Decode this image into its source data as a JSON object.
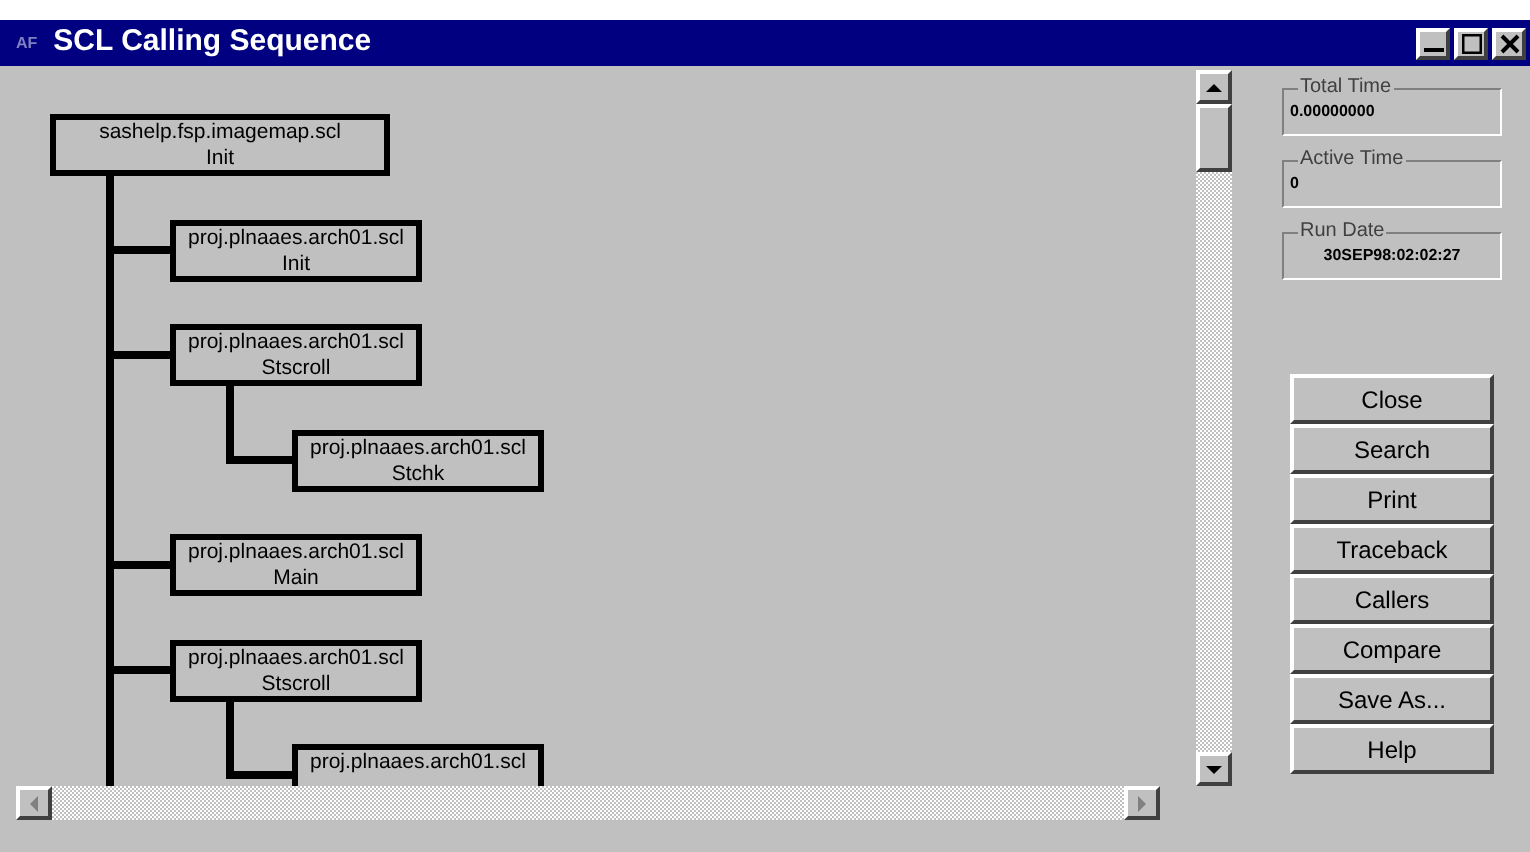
{
  "window": {
    "title": "SCL Calling Sequence",
    "icon_text": "AF"
  },
  "tree": {
    "program": "sashelp.fsp.imagemap.scl",
    "method": "Init",
    "continues": true,
    "children": [
      {
        "program": "proj.plnaaes.arch01.scl",
        "method": "Init"
      },
      {
        "program": "proj.plnaaes.arch01.scl",
        "method": "Stscroll",
        "children": [
          {
            "program": "proj.plnaaes.arch01.scl",
            "method": "Stchk"
          }
        ]
      },
      {
        "program": "proj.plnaaes.arch01.scl",
        "method": "Main"
      },
      {
        "program": "proj.plnaaes.arch01.scl",
        "method": "Stscroll",
        "children": [
          {
            "program": "proj.plnaaes.arch01.scl"
          }
        ]
      }
    ]
  },
  "fields": [
    {
      "label": "Total Time",
      "value": "0.00000000",
      "kind": "time"
    },
    {
      "label": "Active Time",
      "value": "0",
      "kind": "time"
    },
    {
      "label": "Run Date",
      "value": "30SEP98:02:02:27",
      "kind": "date"
    }
  ],
  "buttons": [
    "Close",
    "Search",
    "Print",
    "Traceback",
    "Callers",
    "Compare",
    "Save As...",
    "Help"
  ]
}
